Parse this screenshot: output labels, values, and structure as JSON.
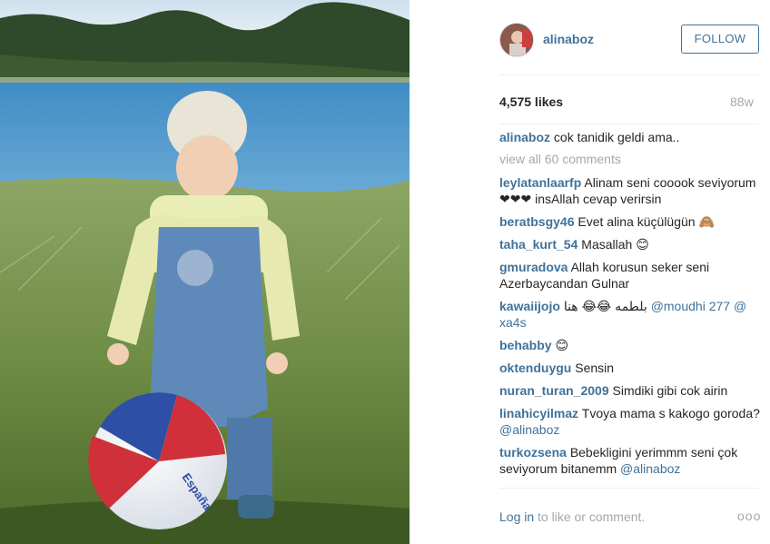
{
  "post": {
    "username": "alinaboz",
    "follow_label": "FOLLOW",
    "likes": "4,575 likes",
    "age": "88w",
    "caption": {
      "user": "alinaboz",
      "text": "cok tanidik geldi ama.."
    },
    "view_all": "view all 60 comments",
    "photo_text": "España"
  },
  "comments": [
    {
      "user": "leylatanlaarfp",
      "text": "Alinam seni cooook seviyorum ❤❤❤ insAllah cevap verirsin"
    },
    {
      "user": "beratbsgy46",
      "text": "Evet alina küçülügün 🙈"
    },
    {
      "user": "taha_kurt_54",
      "text": "Masallah 😊"
    },
    {
      "user": "gmuradova",
      "text": "Allah korusun seker seni Azerbaycandan Gulnar"
    },
    {
      "user": "kawaiijojo",
      "text": "بلطمه 😂😂 هنا",
      "mention": "@moudhi",
      "tail": "277",
      "mention2": "@",
      "tail2": "xa4s"
    },
    {
      "user": "behabby",
      "text": "😊"
    },
    {
      "user": "oktenduygu",
      "text": "Sensin"
    },
    {
      "user": "nuran_turan_2009",
      "text": "Simdiki gibi cok airin"
    },
    {
      "user": "linahicyilmaz",
      "text": "Tvoya mama s kakogo goroda?",
      "mention": "@alinaboz"
    },
    {
      "user": "turkozsena",
      "text": "Bebekligini yerimmm seni çok seviyorum bitanemm",
      "mention": "@alinaboz"
    }
  ],
  "footer": {
    "login_link": "Log in",
    "login_rest": "to like or comment.",
    "more_label": "ooo"
  }
}
